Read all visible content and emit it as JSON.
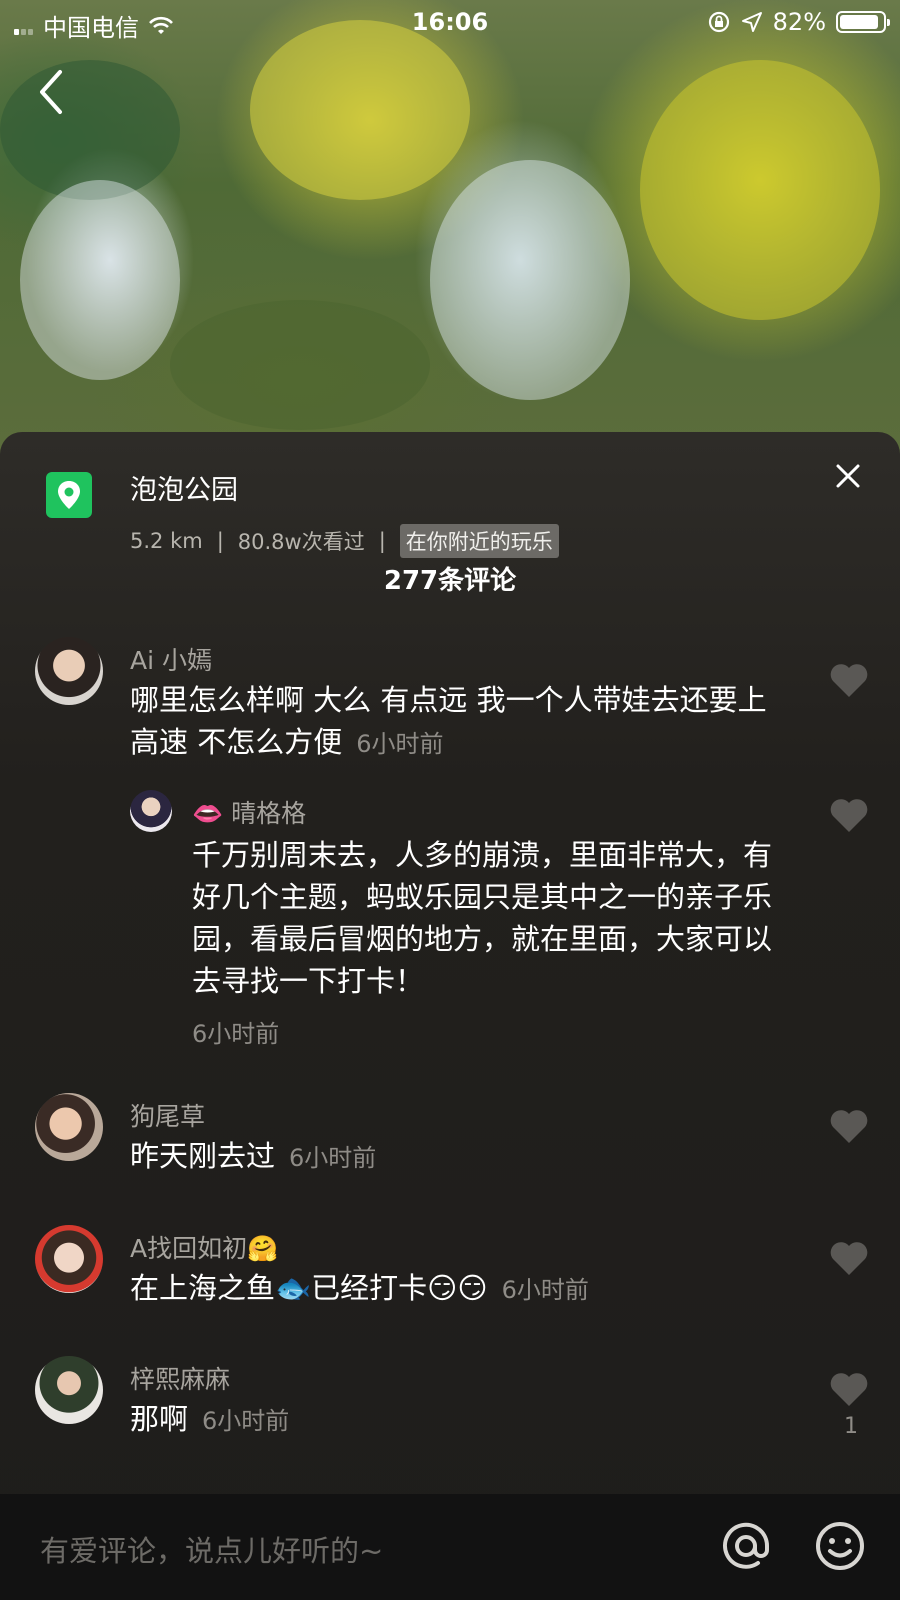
{
  "status_bar": {
    "carrier": "中国电信",
    "time": "16:06",
    "battery": "82%"
  },
  "poi": {
    "name": "泡泡公园",
    "distance": "5.2 km",
    "views": "80.8w次看过",
    "tag": "在你附近的玩乐",
    "icon": "location-pin-icon",
    "icon_color": "#1fc35e"
  },
  "comments_count": "277条评论",
  "comments": [
    {
      "name": "Ai 小嫣",
      "text": "哪里怎么样啊 大么 有点远 我一个人带娃去还要上高速 不怎么方便",
      "time": "6小时前"
    },
    {
      "name": "👄 晴格格",
      "text": "千万别周末去，人多的崩溃，里面非常大，有好几个主题，蚂蚁乐园只是其中之一的亲子乐园，看最后冒烟的地方，就在里面，大家可以去寻找一下打卡！",
      "time": "6小时前"
    },
    {
      "name": "狗尾草",
      "text": "昨天刚去过",
      "time": "6小时前"
    },
    {
      "name": "A找回如初🤗",
      "text": "在上海之鱼🐟已经打卡😏😏",
      "time": "6小时前"
    },
    {
      "name": "梓熙麻麻",
      "text": "那啊",
      "time": "6小时前",
      "likes": "1"
    }
  ],
  "input": {
    "placeholder": "有爱评论，说点儿好听的~"
  }
}
